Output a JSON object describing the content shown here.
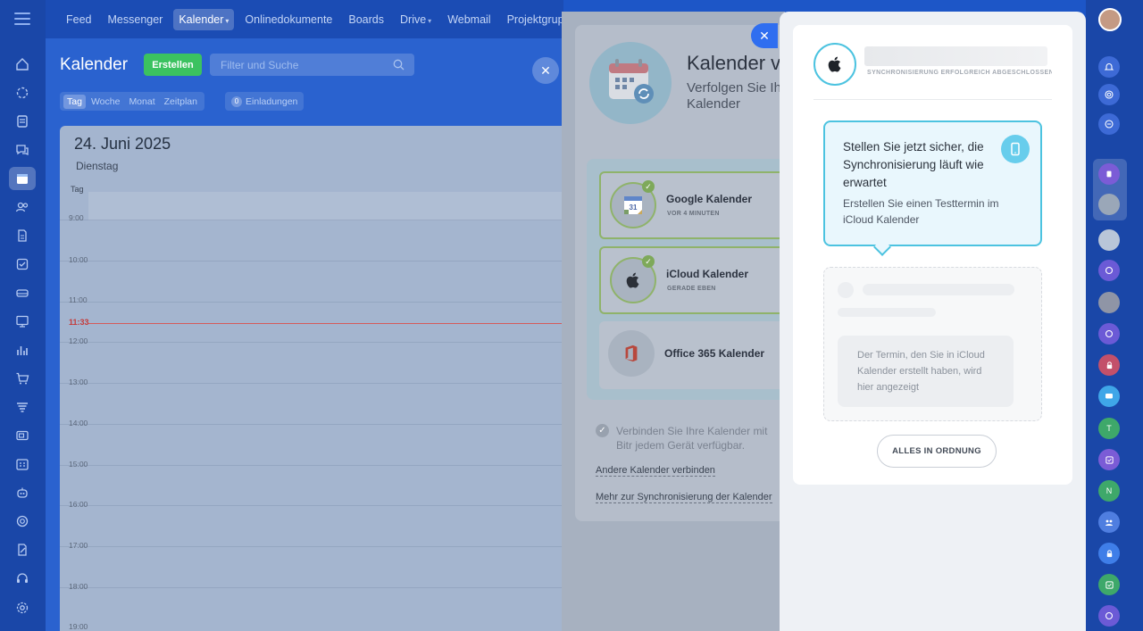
{
  "topnav": {
    "items": [
      {
        "label": "Feed"
      },
      {
        "label": "Messenger"
      },
      {
        "label": "Kalender",
        "active": true,
        "dropdown": true
      },
      {
        "label": "Onlinedokumente"
      },
      {
        "label": "Boards"
      },
      {
        "label": "Drive",
        "dropdown": true
      },
      {
        "label": "Webmail"
      },
      {
        "label": "Projektgruppen"
      }
    ]
  },
  "calendar": {
    "title": "Kalender",
    "create_label": "Erstellen",
    "search_placeholder": "Filter und Suche",
    "views": [
      "Tag",
      "Woche",
      "Monat",
      "Zeitplan"
    ],
    "active_view": "Tag",
    "invites_count": "0",
    "invites_label": "Einladungen",
    "date": "24. Juni 2025",
    "weekday": "Dienstag",
    "day_label": "Tag",
    "now": "11:33",
    "hours": [
      "9:00",
      "10:00",
      "11:00",
      "12:00",
      "13:00",
      "14:00",
      "15:00",
      "16:00",
      "17:00",
      "18:00",
      "19:00"
    ]
  },
  "sync_panel": {
    "title": "Kalender v",
    "subtitle": "Verfolgen Sie Ih Kalender",
    "providers": [
      {
        "name": "Google Kalender",
        "status": "VOR 4 MINUTEN",
        "connected": true,
        "icon": "google-calendar-icon"
      },
      {
        "name": "iCloud Kalender",
        "status": "GERADE EBEN",
        "connected": true,
        "icon": "apple-icon"
      },
      {
        "name": "Office 365 Kalender",
        "status": "",
        "connected": false,
        "icon": "office-icon"
      }
    ],
    "footer_text": "Verbinden Sie Ihre Kalender mit Bitr jedem Gerät verfügbar.",
    "link_other": "Andere Kalender verbinden",
    "link_more": "Mehr zur Synchronisierung der Kalender"
  },
  "icloud_popup": {
    "status": "SYNCHRONISIERUNG ERFOLGREICH ABGESCHLOSSEN",
    "bubble_title": "Stellen Sie jetzt sicher, die Synchronisierung läuft wie erwartet",
    "bubble_sub": "Erstellen Sie einen Testtermin im iCloud Kalender",
    "placeholder_text": "Der Termin, den Sie in iCloud Kalender erstellt haben, wird hier angezeigt",
    "ok_label": "ALLES IN ORDNUNG"
  },
  "right_sidebar": {
    "items": [
      {
        "icon": "bell-icon"
      },
      {
        "icon": "chat-spiral-icon"
      },
      {
        "icon": "search-chat-icon"
      },
      {
        "icon": "group-chat-icon"
      },
      {
        "icon": "user-avatar"
      },
      {
        "icon": "user-avatar"
      },
      {
        "icon": "copilot-icon"
      },
      {
        "icon": "user-avatar"
      },
      {
        "icon": "copilot-icon"
      },
      {
        "icon": "lock-icon"
      },
      {
        "icon": "chat-bubble-icon"
      },
      {
        "letter": "T"
      },
      {
        "icon": "tasks-icon"
      },
      {
        "letter": "N"
      },
      {
        "icon": "group-icon"
      },
      {
        "icon": "lock-icon"
      },
      {
        "icon": "tasks-icon"
      },
      {
        "icon": "copilot-icon"
      }
    ]
  },
  "colors": {
    "brand_blue": "#1a47a8",
    "accent_cyan": "#4cc3e0",
    "success_green": "#3bc260"
  }
}
